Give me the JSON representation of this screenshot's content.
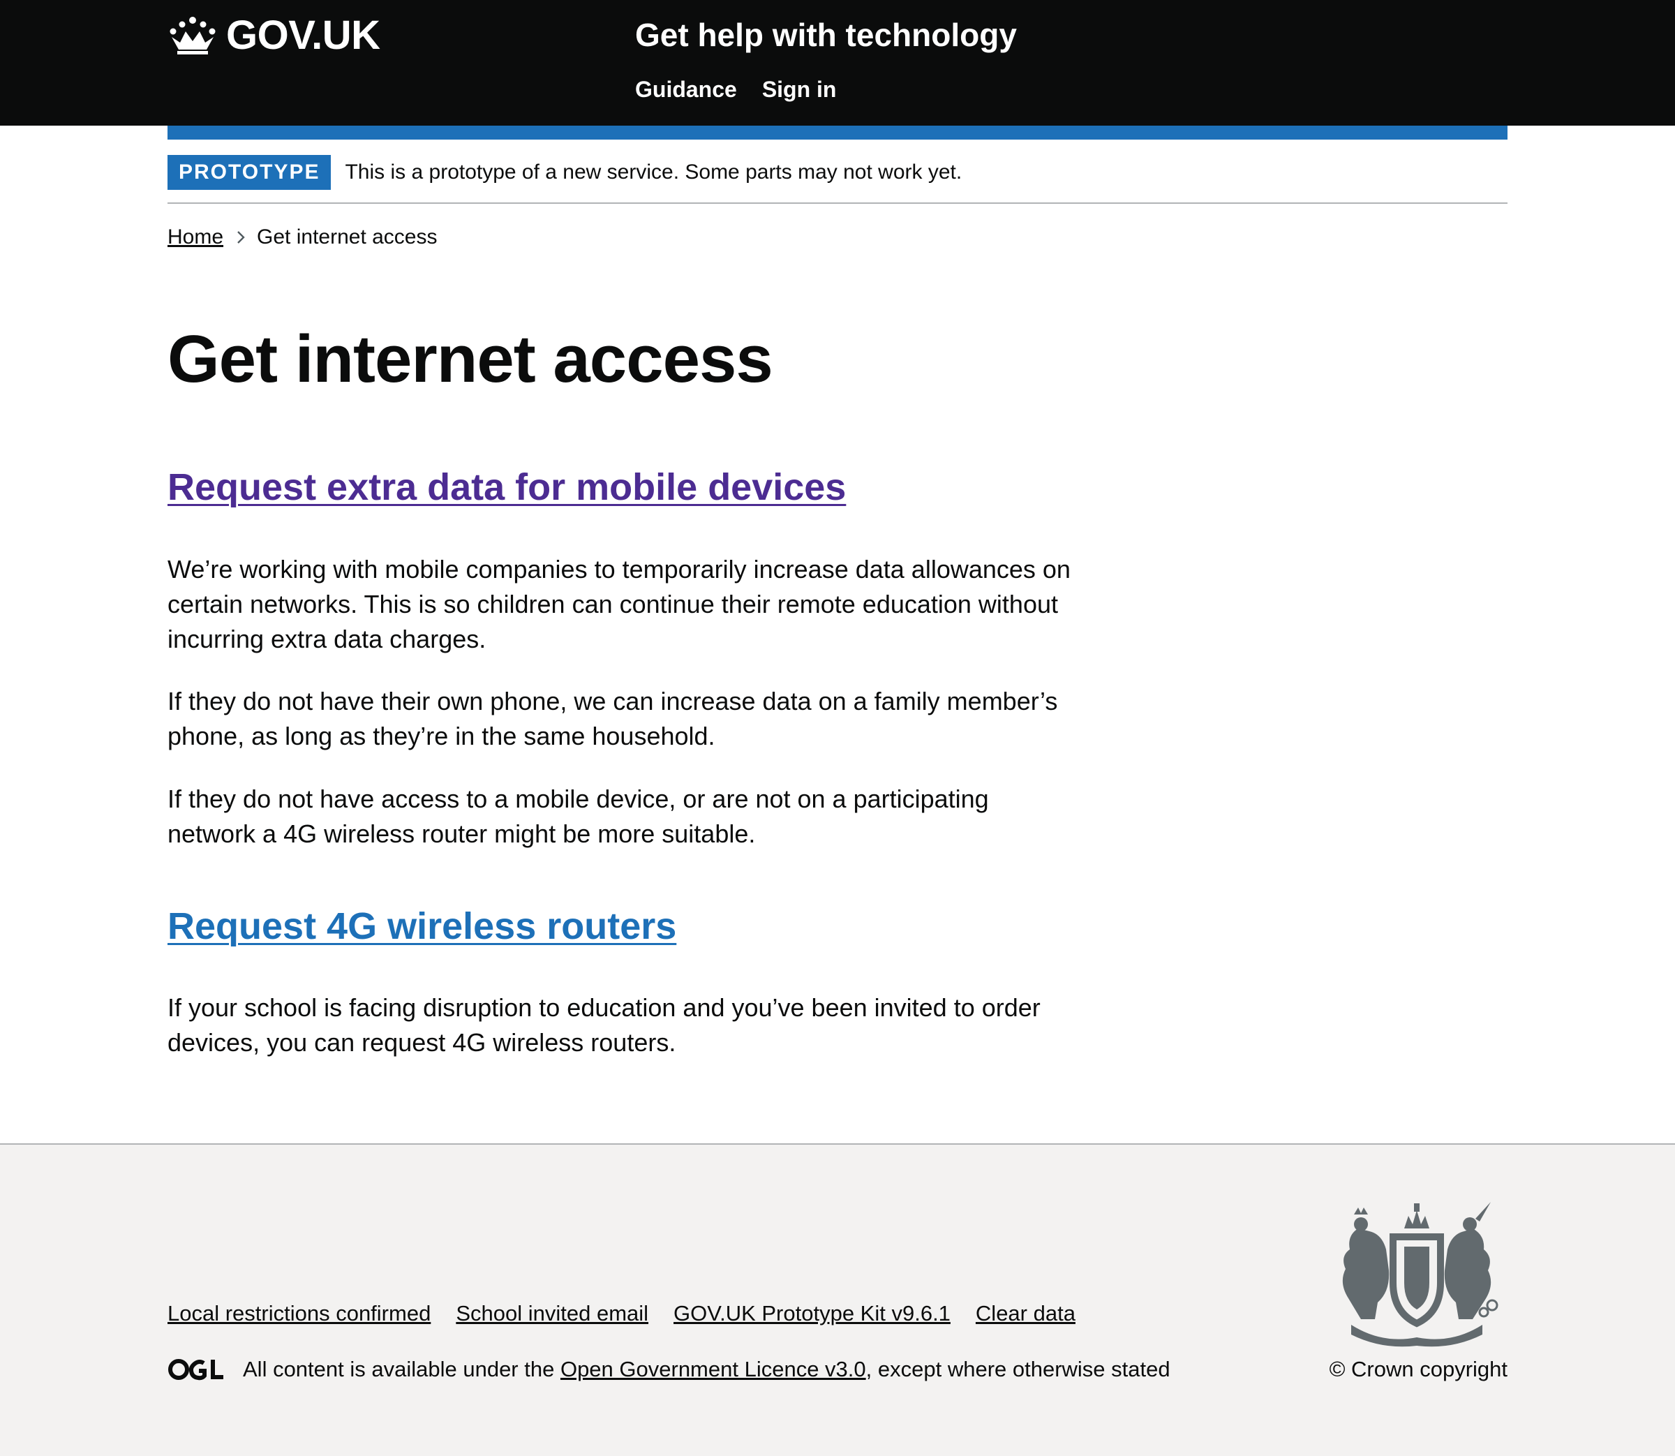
{
  "header": {
    "logo_text": "GOV.UK",
    "logo_icon": "crown-icon",
    "service_name": "Get help with technology",
    "nav": [
      {
        "label": "Guidance"
      },
      {
        "label": "Sign in"
      }
    ]
  },
  "phase_banner": {
    "tag": "PROTOTYPE",
    "text": "This is a prototype of a new service. Some parts may not work yet."
  },
  "breadcrumb": {
    "home": "Home",
    "current": "Get internet access",
    "separator_icon": "chevron-right-icon"
  },
  "main": {
    "title": "Get internet access",
    "sections": [
      {
        "heading": "Request extra data for mobile devices",
        "paragraphs": [
          "We’re working with mobile companies to temporarily increase data allowances on certain networks. This is so children can continue their remote education without incurring extra data charges.",
          "If they do not have their own phone, we can increase data on a family member’s phone, as long as they’re in the same household.",
          "If they do not have access to a mobile device, or are not on a participating network a 4G wireless router might be more suitable."
        ]
      },
      {
        "heading": "Request 4G wireless routers",
        "paragraphs": [
          "If your school is facing disruption to education and you’ve been invited to order devices, you can request 4G wireless routers."
        ]
      }
    ]
  },
  "footer": {
    "links": [
      {
        "label": "Local restrictions confirmed"
      },
      {
        "label": "School invited email"
      },
      {
        "label": "GOV.UK Prototype Kit v9.6.1"
      },
      {
        "label": "Clear data"
      }
    ],
    "licence_prefix": "All content is available under the ",
    "licence_link": "Open Government Licence v3.0",
    "licence_suffix": ", except where otherwise stated",
    "ogl_icon": "ogl-logo-icon",
    "crest_icon": "royal-coat-of-arms-icon",
    "copyright": "© Crown copyright"
  },
  "colors": {
    "header_bg": "#0b0c0c",
    "brand_blue": "#1d70b8",
    "visited_link": "#4c2c92",
    "footer_bg": "#f3f2f1",
    "text": "#0b0c0c"
  }
}
